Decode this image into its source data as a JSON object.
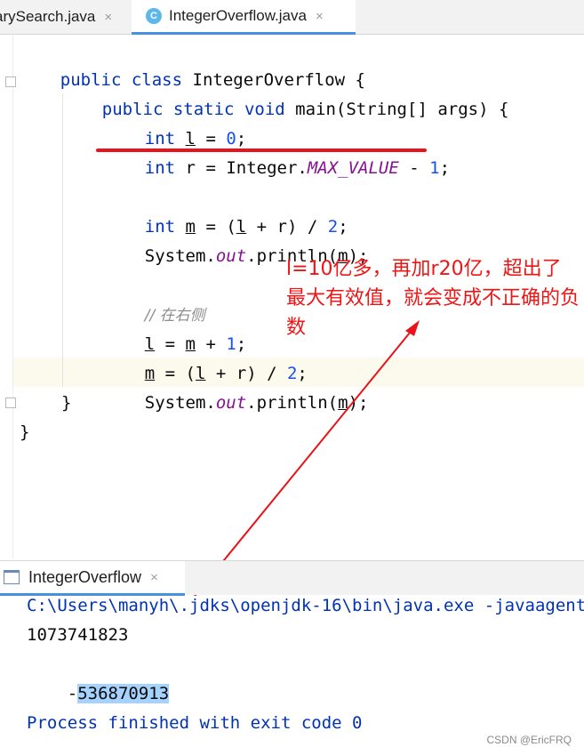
{
  "editor_tabs": [
    {
      "label": "arySearch.java",
      "close": "×"
    },
    {
      "label": "IntegerOverflow.java",
      "icon": "C",
      "close": "×"
    }
  ],
  "code": {
    "l1": {
      "kw1": "public",
      "kw2": "class",
      "name": "IntegerOverflow {"
    },
    "l2": {
      "kw1": "public",
      "kw2": "static",
      "kw3": "void",
      "rest": "main(String[] args) {"
    },
    "l3": {
      "kw": "int",
      "var": "l",
      "eq": " = ",
      "num": "0",
      "end": ";"
    },
    "l4": {
      "kw": "int",
      "var": "r",
      "mid": " = Integer.",
      "const": "MAX_VALUE",
      "op": " - ",
      "num": "1",
      "end": ";"
    },
    "l5": {
      "kw": "int",
      "var": "m",
      "mid1": " = (",
      "var2": "l",
      "mid2": " + r) / ",
      "num": "2",
      "end": ";"
    },
    "l6": {
      "pre": "System.",
      "field": "out",
      "mid": ".println(",
      "var": "m",
      "end": ");"
    },
    "l7": {
      "comment": "// 在右侧"
    },
    "l8": {
      "var": "l",
      "mid1": " = ",
      "var2": "m",
      "mid2": " + ",
      "num": "1",
      "end": ";"
    },
    "l9": {
      "var": "m",
      "mid1": " = (",
      "var2": "l",
      "mid2": " + r) / ",
      "num": "2",
      "end": ";"
    },
    "l10": {
      "pre": "System.",
      "field": "out",
      "mid": ".println(",
      "var": "m",
      "end": ");"
    },
    "l11": "}",
    "l12": "}"
  },
  "annotation": "l=10亿多，再加r20亿，超出了最大有效值，就会变成不正确的负数",
  "run_tab": {
    "label": "IntegerOverflow",
    "close": "×"
  },
  "console": {
    "cmd": "C:\\Users\\manyh\\.jdks\\openjdk-16\\bin\\java.exe -javaagent",
    "out1": "1073741823",
    "out2_sign": "-",
    "out2_selected": "536870913",
    "exit": "Process finished with exit code 0"
  },
  "watermark": "CSDN @EricFRQ",
  "colors": {
    "annotation": "#f01414",
    "keyword": "#0033b3",
    "number": "#1750eb",
    "constant": "#871094",
    "selection": "#a6d2ff"
  }
}
